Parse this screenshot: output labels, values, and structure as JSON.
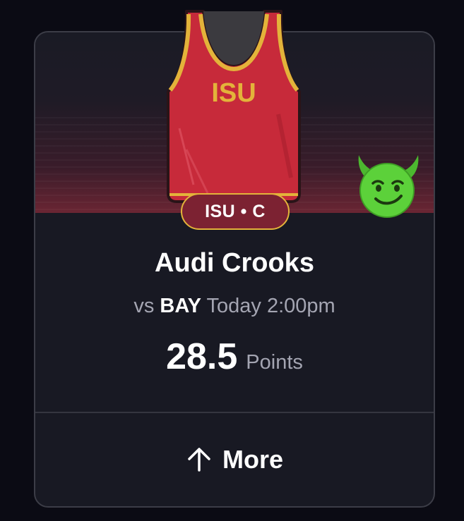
{
  "card": {
    "team_position_badge": "ISU • C",
    "jersey_text": "ISU",
    "jersey_icon": "basketball-jersey-icon",
    "reaction_icon": "green-devil-emoji-icon",
    "player_name": "Audi Crooks",
    "matchup": {
      "prefix": "vs",
      "opponent": "BAY",
      "time": "Today 2:00pm"
    },
    "line": {
      "value": "28.5",
      "stat": "Points"
    },
    "more_label": "More",
    "more_icon": "arrow-up-icon"
  },
  "colors": {
    "background": "#0b0b14",
    "card": "#181923",
    "jersey_red": "#c72a3a",
    "jersey_gold": "#e3b33a",
    "badge_fill": "#7c2232",
    "emoji_green": "#5cd13a"
  }
}
